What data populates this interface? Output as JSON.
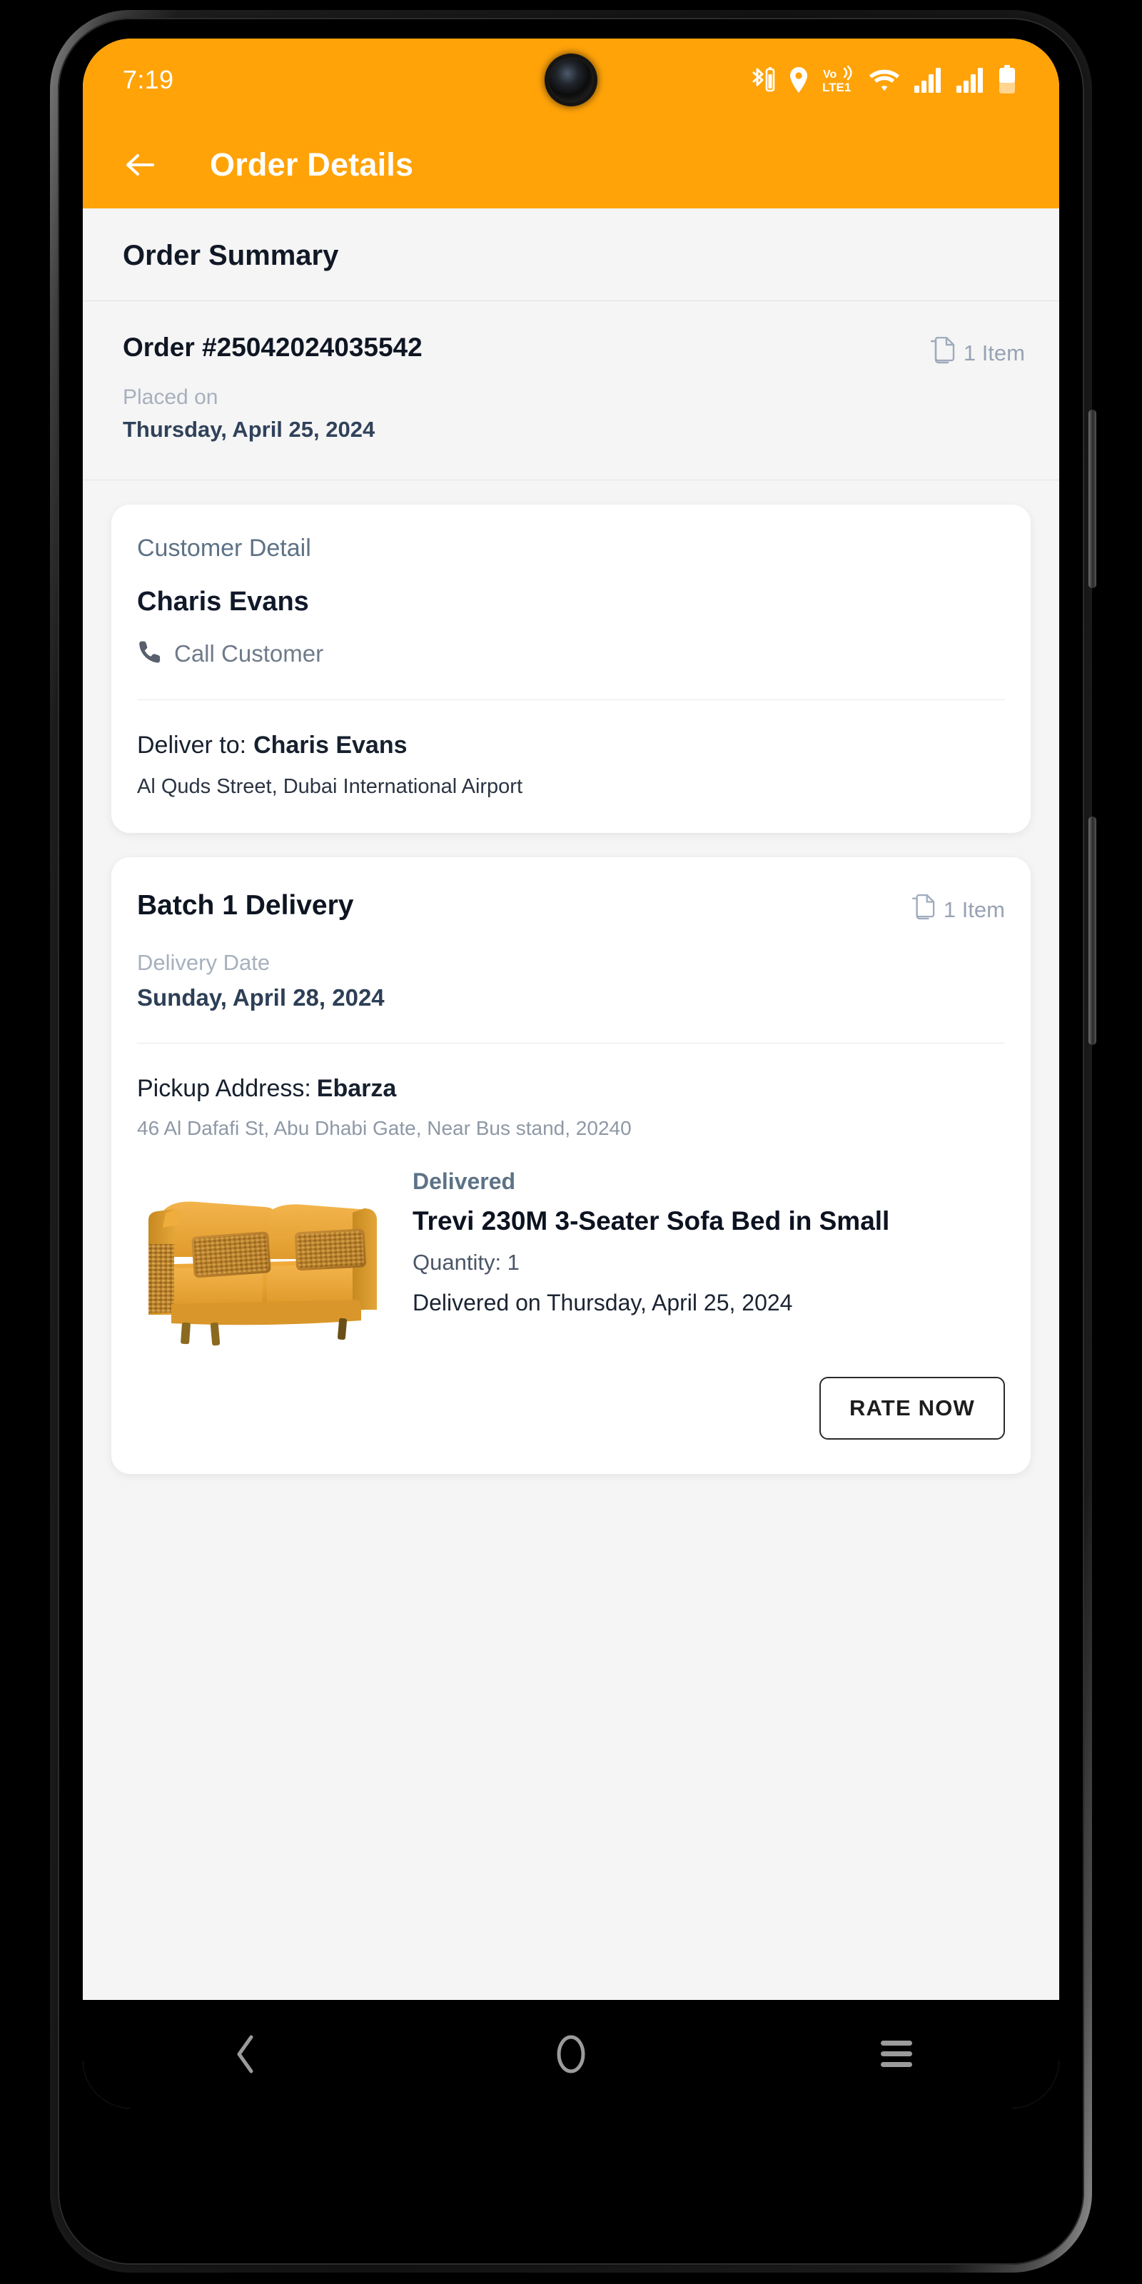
{
  "status_bar": {
    "time": "7:19",
    "icons": [
      "bluetooth-battery-icon",
      "location-pin-icon",
      "volte1-icon",
      "wifi-icon",
      "signal-bars-sim1-icon",
      "signal-bars-sim2-icon",
      "battery-icon"
    ]
  },
  "app_bar": {
    "back_icon": "arrow-left-icon",
    "title": "Order Details",
    "background_color": "#FFA309"
  },
  "order_summary": {
    "section_title": "Order Summary",
    "order_number": "Order #25042024035542",
    "item_count": "1 Item",
    "item_count_icon": "copy-documents-icon",
    "placed_on_label": "Placed on",
    "placed_on_date": "Thursday, April 25, 2024"
  },
  "customer_detail": {
    "label": "Customer Detail",
    "name": "Charis  Evans",
    "call_icon": "phone-icon",
    "call_label": "Call Customer",
    "deliver_to_label": "Deliver to:",
    "deliver_to_name": "Charis  Evans",
    "address": "Al Quds Street, Dubai International Airport"
  },
  "batch_delivery": {
    "title": "Batch 1 Delivery",
    "item_count": "1 Item",
    "item_count_icon": "copy-documents-icon",
    "delivery_date_label": "Delivery Date",
    "delivery_date_value": "Sunday, April 28, 2024",
    "pickup_label": "Pickup Address:",
    "pickup_name": "Ebarza",
    "pickup_address": "46 Al Dafafi St, Abu Dhabi Gate, Near Bus stand, 20240",
    "product": {
      "image_alt": "yellow-3-seater-sofa-bed-image",
      "status": "Delivered",
      "name": "Trevi 230M 3-Seater Sofa Bed in Small",
      "quantity": "Quantity: 1",
      "delivered_on": "Delivered on Thursday, April 25, 2024",
      "rate_button_label": "RATE NOW"
    }
  },
  "nav_bar": {
    "back_icon": "chevron-left-icon",
    "home_icon": "circle-home-icon",
    "recents_icon": "hamburger-recents-icon"
  },
  "colors": {
    "accent_orange": "#FFA309",
    "page_background": "#F5F5F5",
    "card_background": "#FFFFFF",
    "muted_text": "#A7B0BD",
    "heading_text": "#10182A"
  }
}
